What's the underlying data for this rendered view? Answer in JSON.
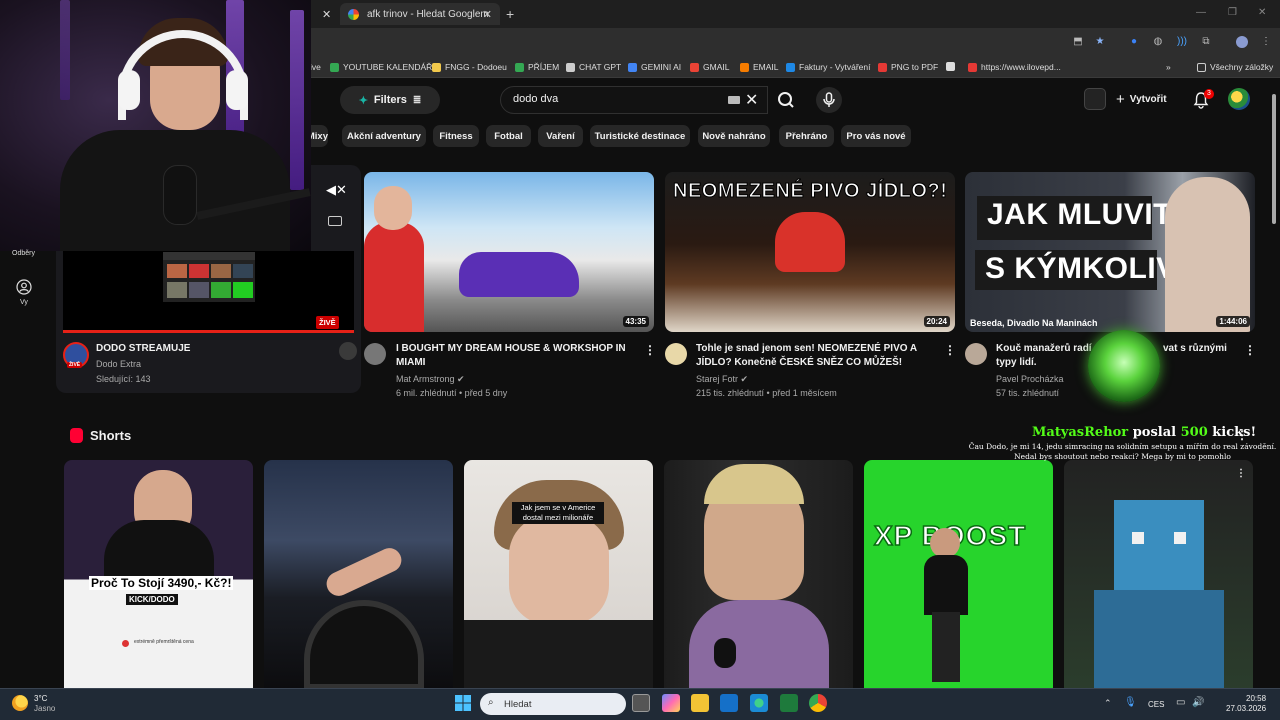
{
  "browser": {
    "active_tab_title": "afk trinov - Hledat Googlem",
    "bookmarks": [
      {
        "label": "ive",
        "color": "#888888"
      },
      {
        "label": "YOUTUBE KALENDÁŘ",
        "color": "#34a853"
      },
      {
        "label": "FNGG - Dodoeu",
        "color": "#f2c94c"
      },
      {
        "label": "PŘÍJEM",
        "color": "#34a853"
      },
      {
        "label": "CHAT GPT",
        "color": "#cccccc"
      },
      {
        "label": "GEMINI AI",
        "color": "#4285f4"
      },
      {
        "label": "GMAIL",
        "color": "#ea4335"
      },
      {
        "label": "EMAIL",
        "color": "#f57c00"
      },
      {
        "label": "Faktury - Vytváření",
        "color": "#1e88e5"
      },
      {
        "label": "PNG to PDF",
        "color": "#e53935"
      },
      {
        "label": "",
        "color": "#dddddd"
      },
      {
        "label": "https://www.ilovepd...",
        "color": "#e53935"
      }
    ],
    "more_bookmarks_label": "»",
    "all_bookmarks_label": "Všechny záložky"
  },
  "header": {
    "filters_label": "Filters",
    "search_value": "dodo dva",
    "create_label": "Vytvořit",
    "notification_count": "3"
  },
  "chips": [
    "Mixy",
    "Akční adventury",
    "Fitness",
    "Fotbal",
    "Vaření",
    "Turistické destinace",
    "Nově nahráno",
    "Přehráno",
    "Pro vás nové"
  ],
  "sidebar": {
    "subscriptions_label": "Odběry",
    "you_label": "Vy"
  },
  "live": {
    "badge": "ŽIVĚ",
    "avatar_badge": "ŽIVĚ",
    "title": "DODO STREAMUJE",
    "channel": "Dodo Extra",
    "followers": "Sledující: 143"
  },
  "videos": [
    {
      "title": "I BOUGHT MY DREAM HOUSE & WORKSHOP IN MIAMI",
      "channel": "Mat Armstrong",
      "meta": "6 mil. zhlédnutí • před 5 dny",
      "duration": "43:35"
    },
    {
      "title": "Tohle je snad jenom sen! NEOMEZENÉ PIVO A JÍDLO? Konečně ČESKÉ SNĚZ CO MŮŽEŠ!",
      "channel": "Starej Fotr",
      "meta": "215 tis. zhlédnutí • před 1 měsícem",
      "duration": "20:24",
      "thumb_text": "NEOMEZENÉ PIVO JÍDLO?!"
    },
    {
      "title": "Kouč manažerů radí, jak mluvit s různými typy lidí.",
      "title_visible": "Kouč manažerů radí",
      "title_tail": "vat s různými",
      "title_line2": "typy lidí.",
      "channel": "Pavel Procházka",
      "meta": "57 tis. zhlédnutí",
      "duration": "1:44:06",
      "thumb_text_1": "JAK MLUVIT",
      "thumb_text_2": "S KÝMKOLIV",
      "thumb_caption": "Beseda, Divadlo Na Maninách"
    }
  ],
  "shorts": {
    "section_title": "Shorts",
    "items": [
      {
        "caption": "Proč To Stojí 3490,- Kč?!",
        "sub": "KICK/DODO",
        "bullet": "extrémně přemrštěná cena"
      },
      {
        "caption": ""
      },
      {
        "caption": "Jak jsem se v Americe dostal mezi milionáře"
      },
      {
        "caption": ""
      },
      {
        "caption": "XP BOOST"
      },
      {
        "caption": ""
      }
    ]
  },
  "kick_alert": {
    "user": "MatyasRehor",
    "middle": " poslal ",
    "amount": "500",
    "suffix": " kicks!",
    "message": "Čau Dodo, je mi 14, jedu simracing na solidním setupu a mířím do real závodění. Nedal bys shoutout nebo reakci? Mega by mi to pomohlo"
  },
  "taskbar": {
    "temperature": "3°C",
    "weather": "Jasno",
    "search_placeholder": "Hledat",
    "language": "CES",
    "time": "20:58",
    "date": "27.03.2026"
  },
  "colors": {
    "background": "#0f0f0f",
    "accent_red": "#ff0033",
    "kick_green": "#53fc18",
    "taskbar": "#202a36"
  }
}
